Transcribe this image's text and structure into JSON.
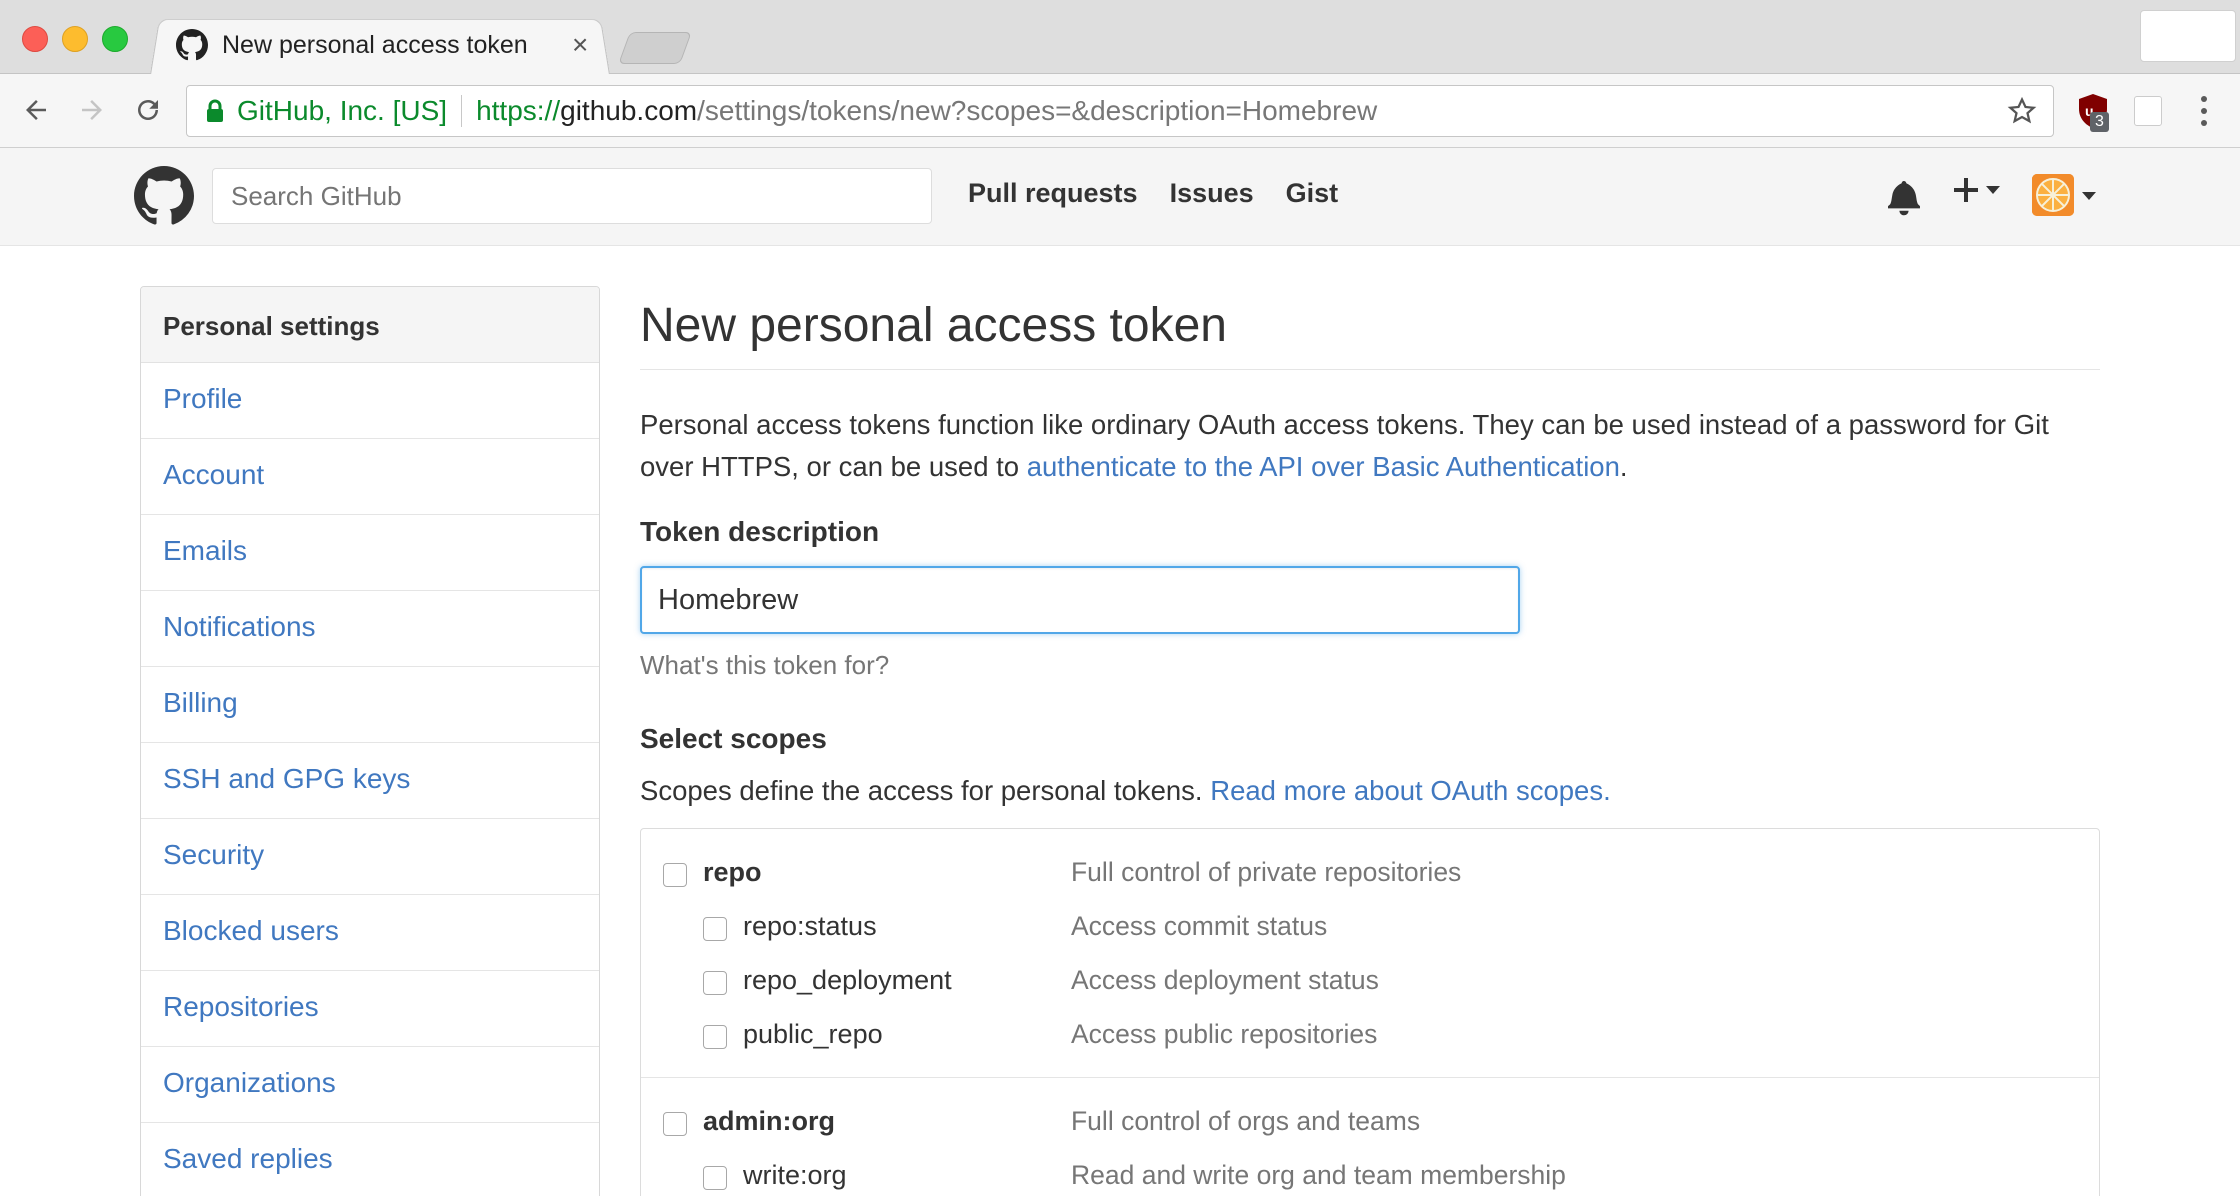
{
  "browser": {
    "tab_title": "New personal access token",
    "tab_close": "×",
    "org_name": "GitHub, Inc. [US]",
    "url_scheme": "https://",
    "url_host": "github.com",
    "url_path": "/settings/tokens/new?scopes=&description=Homebrew",
    "extension_badge": "3"
  },
  "header": {
    "search_placeholder": "Search GitHub",
    "nav": [
      "Pull requests",
      "Issues",
      "Gist"
    ]
  },
  "sidebar": {
    "title": "Personal settings",
    "items": [
      "Profile",
      "Account",
      "Emails",
      "Notifications",
      "Billing",
      "SSH and GPG keys",
      "Security",
      "Blocked users",
      "Repositories",
      "Organizations",
      "Saved replies"
    ]
  },
  "main": {
    "title": "New personal access token",
    "intro_text": "Personal access tokens function like ordinary OAuth access tokens. They can be used instead of a password for Git over HTTPS, or can be used to ",
    "intro_link": "authenticate to the API over Basic Authentication",
    "intro_end": ".",
    "token_label": "Token description",
    "token_value": "Homebrew",
    "token_hint": "What's this token for?",
    "scopes_label": "Select scopes",
    "scopes_intro": "Scopes define the access for personal tokens. ",
    "scopes_link": "Read more about OAuth scopes."
  },
  "scopes": [
    {
      "name": "repo",
      "description": "Full control of private repositories",
      "checked": false,
      "children": [
        {
          "name": "repo:status",
          "description": "Access commit status",
          "checked": false
        },
        {
          "name": "repo_deployment",
          "description": "Access deployment status",
          "checked": false
        },
        {
          "name": "public_repo",
          "description": "Access public repositories",
          "checked": false
        }
      ]
    },
    {
      "name": "admin:org",
      "description": "Full control of orgs and teams",
      "checked": false,
      "children": [
        {
          "name": "write:org",
          "description": "Read and write org and team membership",
          "checked": false
        }
      ]
    }
  ],
  "colors": {
    "link": "#4078c0",
    "focus": "#51a7e8",
    "secure_green": "#0b8a2c"
  }
}
